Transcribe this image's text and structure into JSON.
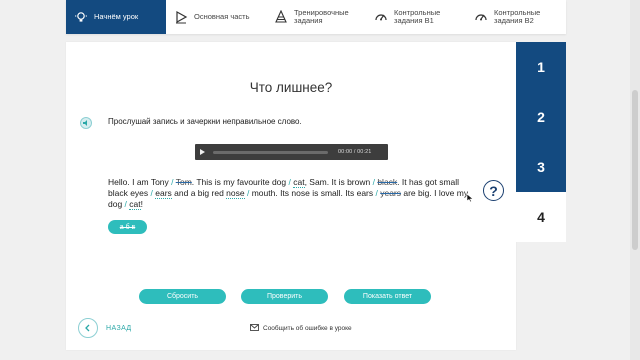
{
  "nav": {
    "tabs": [
      {
        "label": "Начнём урок",
        "icon": "bulb-icon",
        "active": true
      },
      {
        "label": "Основная часть",
        "icon": "play-icon",
        "active": false
      },
      {
        "label": "Тренировочные задания",
        "icon": "cone-icon",
        "active": false
      },
      {
        "label": "Контрольные задания В1",
        "icon": "gauge-icon",
        "active": false
      },
      {
        "label": "Контрольные задания В2",
        "icon": "gauge-icon",
        "active": false
      }
    ]
  },
  "main": {
    "title": "Что лишнее?",
    "instruction": "Прослушай запись и зачеркни неправильное слово.",
    "player": {
      "time": "00:00 / 00:21"
    },
    "text_segments": [
      {
        "t": "Hello. I am Tony ",
        "s": "plain"
      },
      {
        "t": "/ ",
        "s": "sep"
      },
      {
        "t": "Tom",
        "s": "strike"
      },
      {
        "t": ". This is my favourite dog ",
        "s": "plain"
      },
      {
        "t": "/ ",
        "s": "sep"
      },
      {
        "t": "cat",
        "s": "dot"
      },
      {
        "t": ", Sam. It is brown ",
        "s": "plain"
      },
      {
        "t": "/ ",
        "s": "sep"
      },
      {
        "t": "black",
        "s": "strike"
      },
      {
        "t": ". It has got small black eyes ",
        "s": "plain"
      },
      {
        "t": "/ ",
        "s": "sep"
      },
      {
        "t": "ears",
        "s": "dot"
      },
      {
        "t": " and a big red ",
        "s": "plain"
      },
      {
        "t": "nose",
        "s": "dot"
      },
      {
        "t": " ",
        "s": "plain"
      },
      {
        "t": "/ ",
        "s": "sep"
      },
      {
        "t": "mouth. Its nose is small. Its ears ",
        "s": "plain"
      },
      {
        "t": "/ ",
        "s": "sep"
      },
      {
        "t": "years",
        "s": "strike"
      },
      {
        "t": " are big. I love my dog ",
        "s": "plain"
      },
      {
        "t": "/ ",
        "s": "sep"
      },
      {
        "t": "cat",
        "s": "dot"
      },
      {
        "t": "!",
        "s": "plain"
      }
    ],
    "help_label": "?",
    "pill_label": "а б в",
    "buttons": {
      "reset": "Сбросить",
      "check": "Проверить",
      "show": "Показать ответ"
    },
    "back_label": "НАЗАД",
    "report_label": "Сообщить об ошибке в уроке"
  },
  "numbers": {
    "items": [
      "1",
      "2",
      "3",
      "4"
    ],
    "active": "4"
  },
  "colors": {
    "navy": "#134a80",
    "teal": "#2ebdbc"
  }
}
